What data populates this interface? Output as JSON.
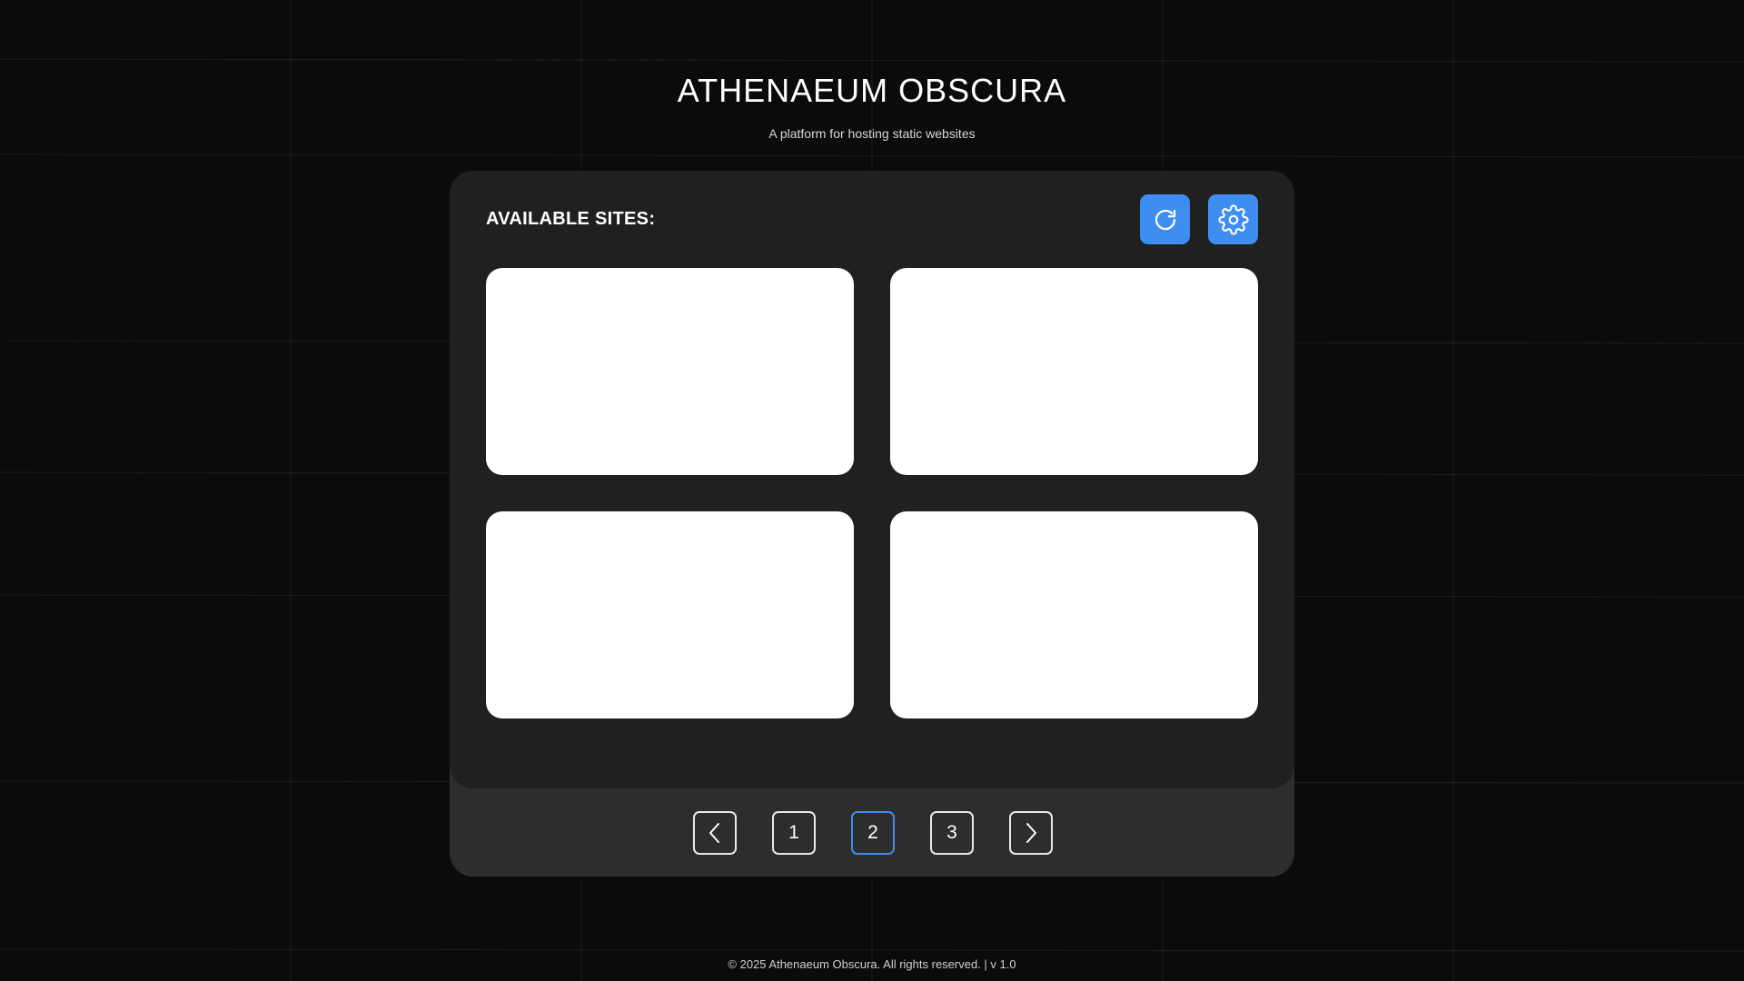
{
  "header": {
    "title": "ATHENAEUM OBSCURA",
    "subtitle": "A platform for hosting static websites"
  },
  "panel": {
    "section_title": "AVAILABLE SITES:",
    "actions": [
      {
        "icon": "refresh-icon",
        "color": "#3d8ef0"
      },
      {
        "icon": "gear-icon",
        "color": "#3d8ef0"
      }
    ],
    "site_cards": [
      {
        "content": ""
      },
      {
        "content": ""
      },
      {
        "content": ""
      },
      {
        "content": ""
      }
    ]
  },
  "pagination": {
    "prev_icon": "chevron-left-icon",
    "next_icon": "chevron-right-icon",
    "pages": [
      "1",
      "2",
      "3"
    ],
    "current_page": "2",
    "active_color": "#3d8ef0"
  },
  "footer": {
    "text": "© 2025 Athenaeum Obscura. All rights reserved. | v 1.0"
  }
}
